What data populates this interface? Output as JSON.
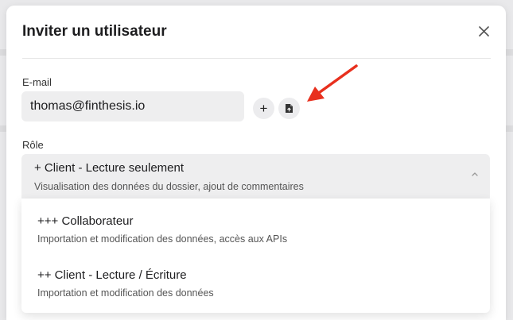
{
  "modal": {
    "title": "Inviter un utilisateur",
    "close_icon": "close-icon"
  },
  "email": {
    "label": "E-mail",
    "value": "thomas@finthesis.io",
    "add_button_label": "+",
    "file_button_icon": "file-icon"
  },
  "annotation": {
    "arrow_color": "#e8301e"
  },
  "role": {
    "label": "Rôle",
    "selected": {
      "title": "+ Client - Lecture seulement",
      "description": "Visualisation des données du dossier, ajout de commentaires"
    },
    "options": [
      {
        "title": "+++ Collaborateur",
        "description": "Importation et modification des données, accès aux APIs"
      },
      {
        "title": "++ Client - Lecture / Écriture",
        "description": "Importation et modification des données"
      }
    ]
  }
}
